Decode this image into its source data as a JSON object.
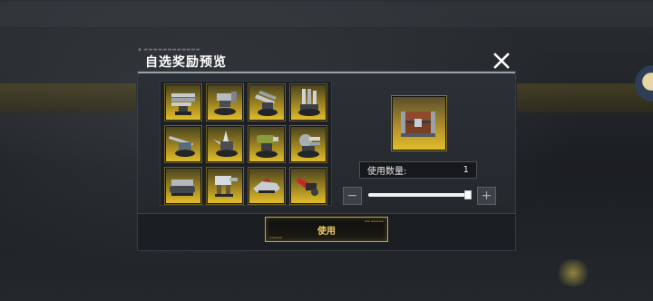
{
  "dialog": {
    "title": "自选奖励预览",
    "use_quantity_label": "使用数量:",
    "use_quantity_value": "1",
    "slider_level": 1.0,
    "use_button_label": "使用"
  },
  "rewards": [
    {
      "icon": "multi-barrel-turret-icon"
    },
    {
      "icon": "gatling-turret-icon"
    },
    {
      "icon": "twin-cannon-turret-icon"
    },
    {
      "icon": "tall-missile-turret-icon"
    },
    {
      "icon": "railgun-turret-icon"
    },
    {
      "icon": "spike-cannon-turret-icon"
    },
    {
      "icon": "heavy-artillery-turret-icon"
    },
    {
      "icon": "rotary-cannon-turret-icon"
    },
    {
      "icon": "tracked-cannon-turret-icon"
    },
    {
      "icon": "mech-gun-turret-icon"
    },
    {
      "icon": "hover-bike-icon"
    },
    {
      "icon": "red-claw-drone-icon"
    }
  ],
  "preview_item": {
    "icon": "supply-chest-icon"
  },
  "colors": {
    "gold_tile": "#e1bd2a",
    "button_text": "#f0d060",
    "button_border": "#c8a63a"
  }
}
